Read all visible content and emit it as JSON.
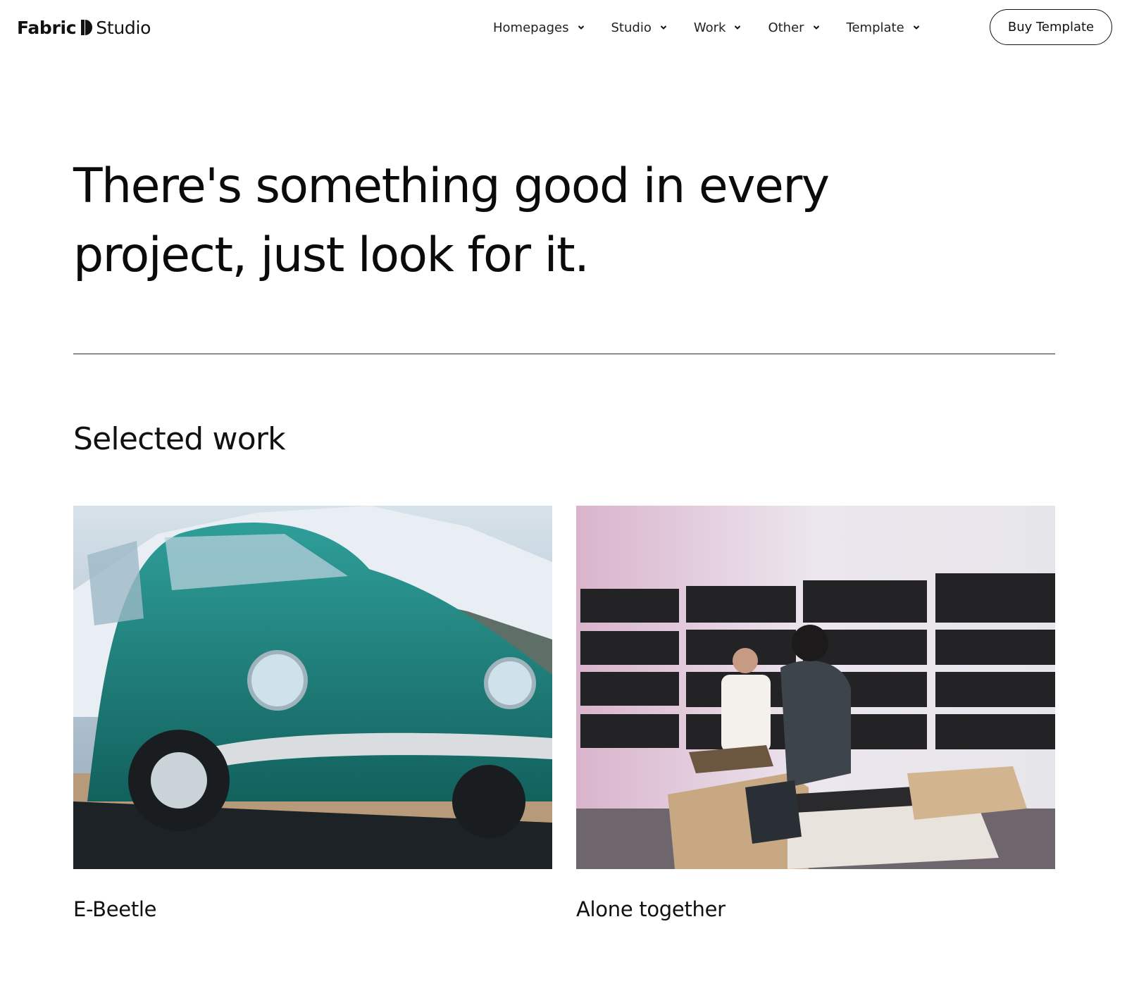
{
  "header": {
    "logo": {
      "part1": "Fabric",
      "part2": "Studio"
    },
    "nav": [
      {
        "label": "Homepages"
      },
      {
        "label": "Studio"
      },
      {
        "label": "Work"
      },
      {
        "label": "Other"
      },
      {
        "label": "Template"
      }
    ],
    "cta_label": "Buy Template"
  },
  "hero": {
    "line1": "There's something good in every",
    "line2": "project, just look for it."
  },
  "section": {
    "title": "Selected work"
  },
  "projects": [
    {
      "title": "E-Beetle",
      "image": "teal-vintage-car-photo"
    },
    {
      "title": "Alone together",
      "image": "gallery-visitors-photo"
    }
  ],
  "colors": {
    "text": "#111111",
    "background": "#ffffff",
    "divider": "#2a2a2a"
  },
  "icons": {
    "nav_dropdown": "chevron-down-icon",
    "logo_mark": "half-circle-logo-icon"
  }
}
